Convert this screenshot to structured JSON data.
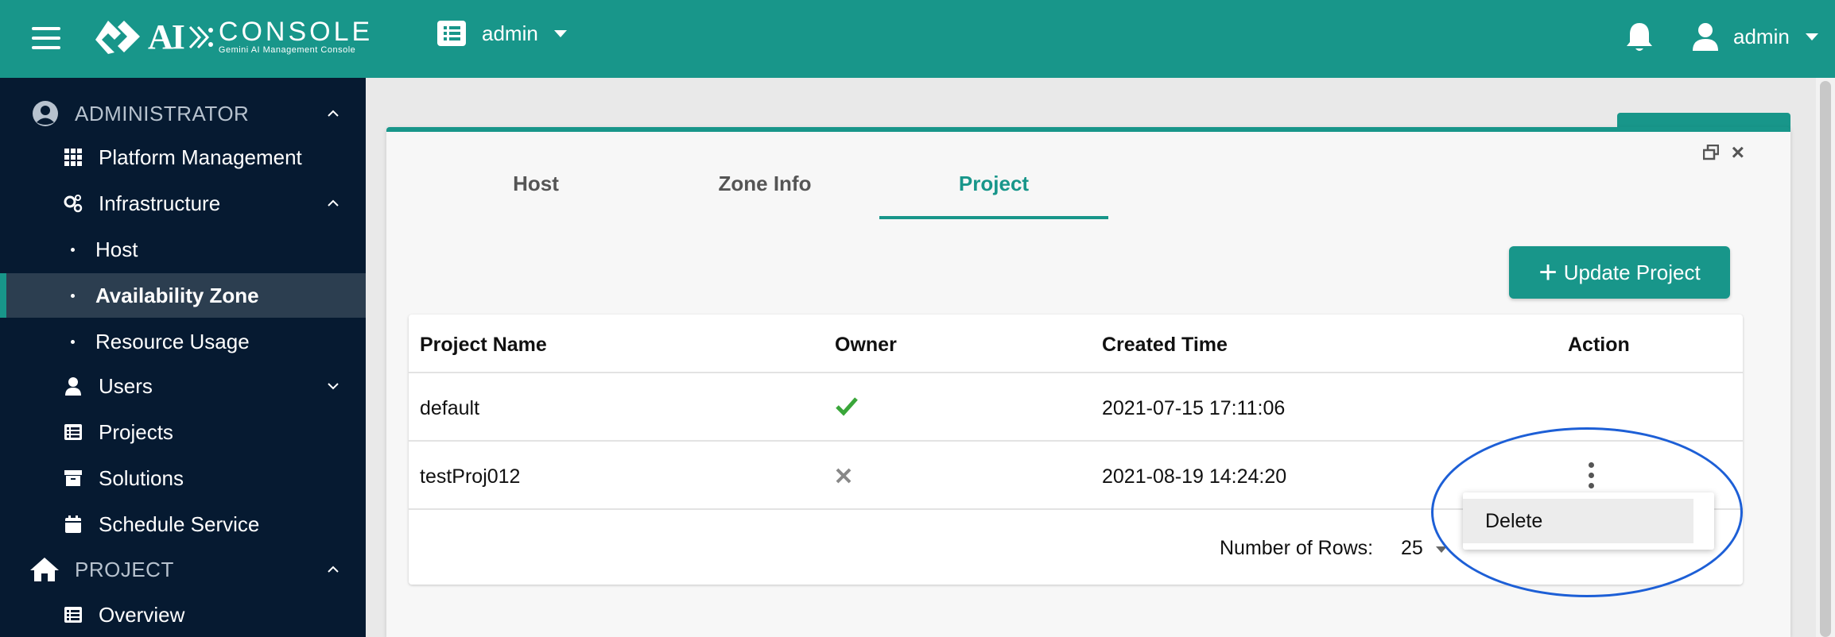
{
  "header": {
    "logo_ai": "AI",
    "logo_title": "CONSOLE",
    "logo_subtitle": "Gemini AI Management Console",
    "workspace_user": "admin",
    "account_user": "admin",
    "accent_color": "#18968a"
  },
  "sidebar": {
    "sections": [
      {
        "label": "ADMINISTRATOR",
        "icon": "user-circle-icon",
        "expanded": true
      },
      {
        "label": "PROJECT",
        "icon": "home-icon",
        "expanded": true
      }
    ],
    "items": [
      {
        "label": "Platform Management",
        "icon": "grid-icon"
      },
      {
        "label": "Infrastructure",
        "icon": "gears-icon",
        "expanded": true
      },
      {
        "label": "Host",
        "sub": true
      },
      {
        "label": "Availability Zone",
        "sub": true,
        "active": true
      },
      {
        "label": "Resource Usage",
        "sub": true
      },
      {
        "label": "Users",
        "icon": "person-icon",
        "expanded": false
      },
      {
        "label": "Projects",
        "icon": "list-icon"
      },
      {
        "label": "Solutions",
        "icon": "archive-icon"
      },
      {
        "label": "Schedule Service",
        "icon": "calendar-icon"
      },
      {
        "label": "Overview",
        "icon": "list-icon"
      }
    ]
  },
  "panel": {
    "tabs": [
      {
        "label": "Host",
        "active": false
      },
      {
        "label": "Zone Info",
        "active": false
      },
      {
        "label": "Project",
        "active": true
      }
    ],
    "update_button": "Update Project",
    "table": {
      "columns": [
        "Project Name",
        "Owner",
        "Created Time",
        "Action"
      ],
      "rows": [
        {
          "name": "default",
          "owner": "check-icon",
          "created": "2021-07-15 17:11:06"
        },
        {
          "name": "testProj012",
          "owner": "x-icon",
          "created": "2021-08-19 14:24:20"
        }
      ]
    },
    "rows_label": "Number of Rows:",
    "rows_value": "25",
    "action_menu": {
      "options": [
        "Delete"
      ]
    }
  }
}
